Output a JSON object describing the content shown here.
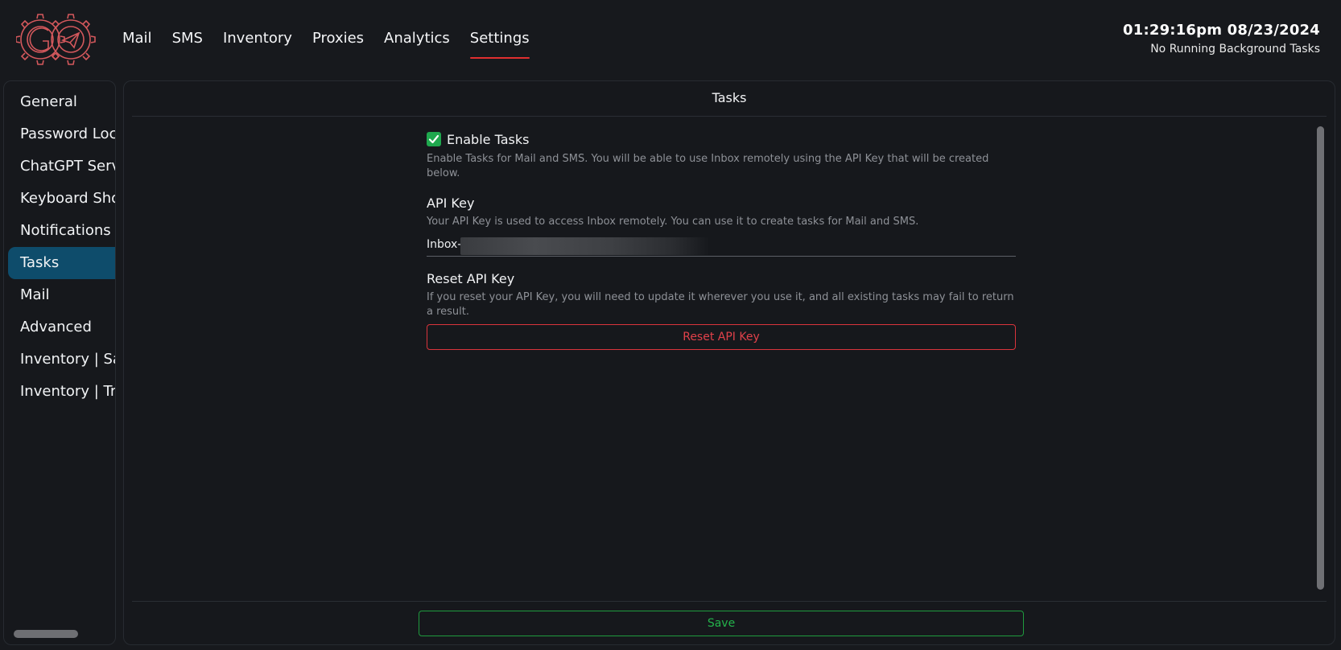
{
  "nav": {
    "items": [
      {
        "label": "Mail"
      },
      {
        "label": "SMS"
      },
      {
        "label": "Inventory"
      },
      {
        "label": "Proxies"
      },
      {
        "label": "Analytics"
      },
      {
        "label": "Settings",
        "active": true
      }
    ]
  },
  "header": {
    "clock": "01:29:16pm 08/23/2024",
    "status": "No Running Background Tasks"
  },
  "sidebar": {
    "items": [
      {
        "label": "General"
      },
      {
        "label": "Password Loc"
      },
      {
        "label": "ChatGPT Serv"
      },
      {
        "label": "Keyboard Sho"
      },
      {
        "label": "Notifications"
      },
      {
        "label": "Tasks",
        "active": true
      },
      {
        "label": "Mail"
      },
      {
        "label": "Advanced"
      },
      {
        "label": "Inventory | Sa"
      },
      {
        "label": "Inventory | Tra"
      }
    ]
  },
  "panel": {
    "title": "Tasks",
    "enable": {
      "label": "Enable Tasks",
      "checked": true,
      "help": "Enable Tasks for Mail and SMS. You will be able to use Inbox remotely using the API Key that will be created below."
    },
    "api_key": {
      "title": "API Key",
      "help": "Your API Key is used to access Inbox remotely. You can use it to create tasks for Mail and SMS.",
      "value_prefix": "Inbox-"
    },
    "reset": {
      "title": "Reset API Key",
      "help": "If you reset your API Key, you will need to update it wherever you use it, and all existing tasks may fail to return a result.",
      "button_label": "Reset API Key"
    },
    "save_label": "Save"
  },
  "colors": {
    "accent_red": "#e02f2f",
    "active_blue": "#0e4c6b",
    "success_green": "#1fa84e",
    "danger": "#d9343c"
  },
  "icons": {
    "logo": "gear-paper-plane-logo",
    "checkbox": "check-icon"
  }
}
